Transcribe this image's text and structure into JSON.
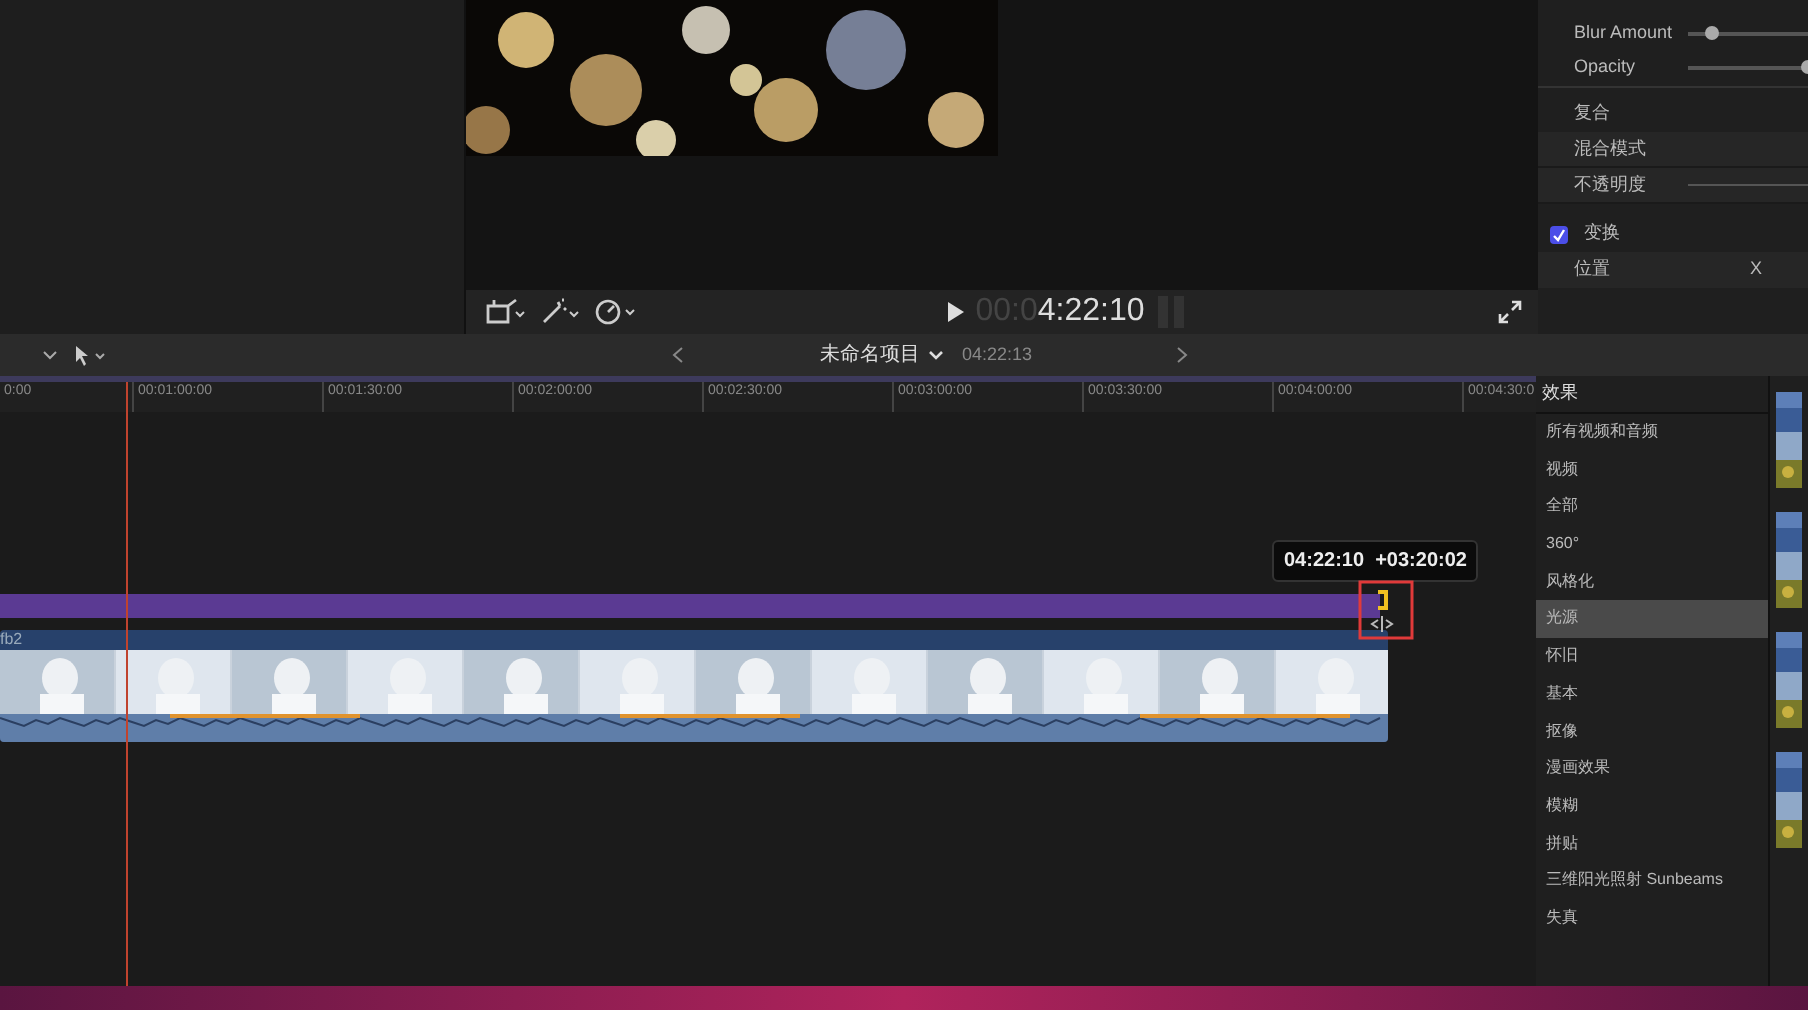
{
  "inspector": {
    "sliders": [
      {
        "label": "Blur Amount",
        "level": 0.2
      },
      {
        "label": "Opacity",
        "level": 1.0
      }
    ],
    "composite": {
      "heading": "复合",
      "rows": [
        {
          "label": "混合模式",
          "kind": "plain"
        },
        {
          "label": "不透明度",
          "kind": "slider"
        }
      ]
    },
    "transform": {
      "label": "变换",
      "checked": true,
      "rows": [
        {
          "label": "位置",
          "axis": "X"
        }
      ]
    }
  },
  "viewer": {
    "kind": "picture",
    "timecode_dim": "00:0",
    "timecode": "4:22:10"
  },
  "timeline_header": {
    "project": "未命名项目",
    "duration": "04:22:13"
  },
  "ruler": [
    "0:00",
    "00:01:00:00",
    "00:01:30:00",
    "00:02:00:00",
    "00:02:30:00",
    "00:03:00:00",
    "00:03:30:00",
    "00:04:00:00",
    "00:04:30:0"
  ],
  "tooltip": "04:22:10  +03:20:02",
  "clip": {
    "name": "fb2"
  },
  "effects": {
    "title": "效果",
    "items": [
      {
        "label": "所有视频和音频",
        "selected": false
      },
      {
        "label": "视频",
        "selected": false
      },
      {
        "label": "全部",
        "selected": false
      },
      {
        "label": "360°",
        "selected": false
      },
      {
        "label": "风格化",
        "selected": false
      },
      {
        "label": "光源",
        "selected": true
      },
      {
        "label": "怀旧",
        "selected": false
      },
      {
        "label": "基本",
        "selected": false
      },
      {
        "label": "抠像",
        "selected": false
      },
      {
        "label": "漫画效果",
        "selected": false
      },
      {
        "label": "模糊",
        "selected": false
      },
      {
        "label": "拼贴",
        "selected": false
      },
      {
        "label": "三维阳光照射 Sunbeams",
        "selected": false
      },
      {
        "label": "失真",
        "selected": false
      }
    ]
  }
}
